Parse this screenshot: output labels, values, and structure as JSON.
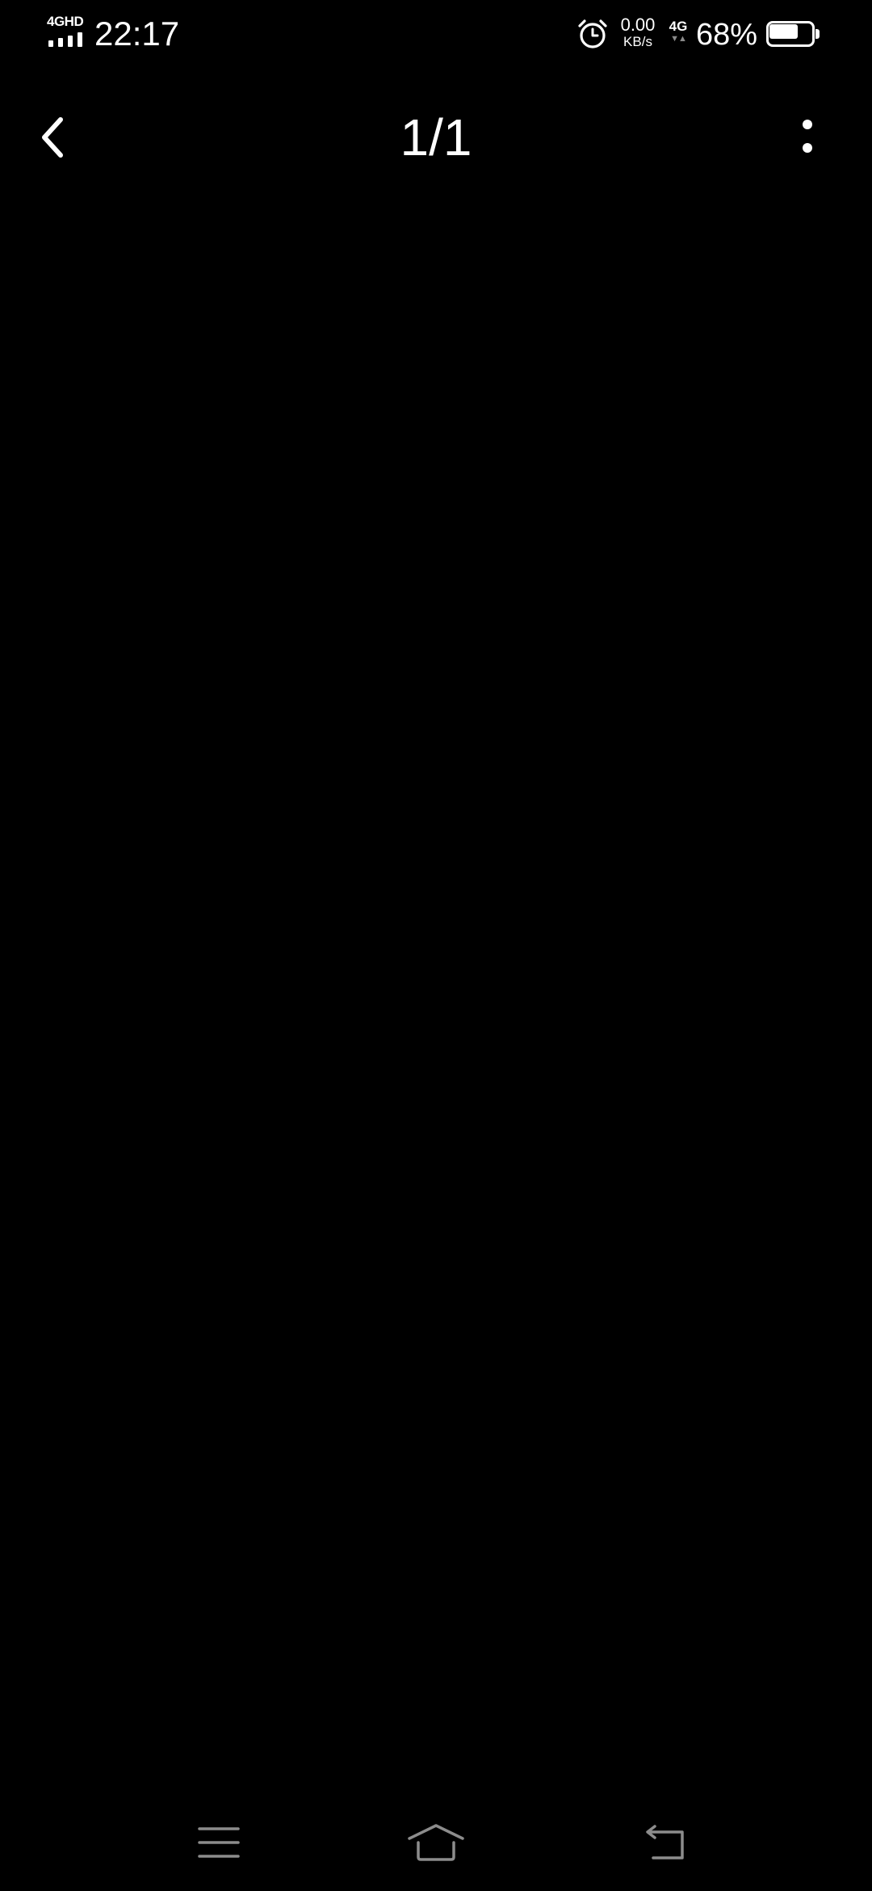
{
  "status_bar": {
    "network_type": "4GHD",
    "time": "22:17",
    "alarm_icon": "alarm-clock-icon",
    "speed_value": "0.00",
    "speed_unit": "KB/s",
    "mobile_data": "4G",
    "mobile_data_arrows": "▼▲",
    "battery_percent": "68%",
    "battery_level": 0.68
  },
  "app_bar": {
    "back_icon": "chevron-left-icon",
    "page_counter": "1/1",
    "more_icon": "more-vertical-icon"
  },
  "nav_bar": {
    "menu_icon": "menu-icon",
    "home_icon": "home-icon",
    "back_icon": "back-arrow-icon"
  },
  "colors": {
    "background": "#000000",
    "foreground": "#ffffff",
    "nav_icons": "#8c8c8c"
  }
}
